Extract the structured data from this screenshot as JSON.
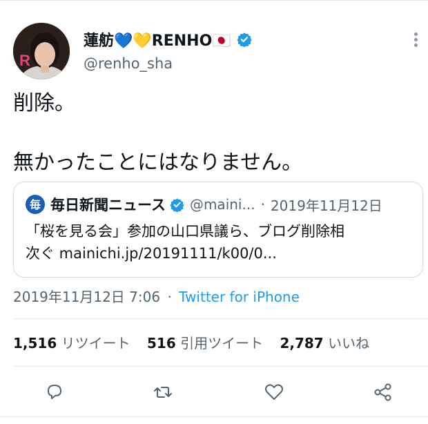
{
  "author": {
    "display_name": "蓮舫💙💛RENHO🇯🇵",
    "handle": "@renho_sha",
    "avatar_letter": "R",
    "verified": true
  },
  "tweet": {
    "line1": "削除。",
    "line2": "無かったことにはなりません。"
  },
  "quoted_tweet": {
    "logo_char": "毎",
    "name": "毎日新聞ニュース",
    "handle": "@maini...",
    "separator": "·",
    "date": "2019年11月12日",
    "text_line1": "「桜を見る会」参加の山口県議ら、ブログ削除相",
    "text_line2": "次ぐ mainichi.jp/20191111/k00/0..."
  },
  "meta": {
    "timestamp": "2019年11月12日 7:06",
    "separator": "·",
    "source": "Twitter for iPhone"
  },
  "stats": {
    "retweets_count": "1,516",
    "retweets_label": "リツイート",
    "quotes_count": "516",
    "quotes_label": "引用ツイート",
    "likes_count": "2,787",
    "likes_label": "いいね"
  },
  "colors": {
    "link": "#1d9bf0",
    "muted": "#536471",
    "text": "#0f1419",
    "verified": "#1d9bf0",
    "border": "#cfd9de"
  },
  "icons": [
    "verified-icon",
    "more-icon",
    "reply-icon",
    "retweet-icon",
    "like-icon",
    "share-icon"
  ]
}
